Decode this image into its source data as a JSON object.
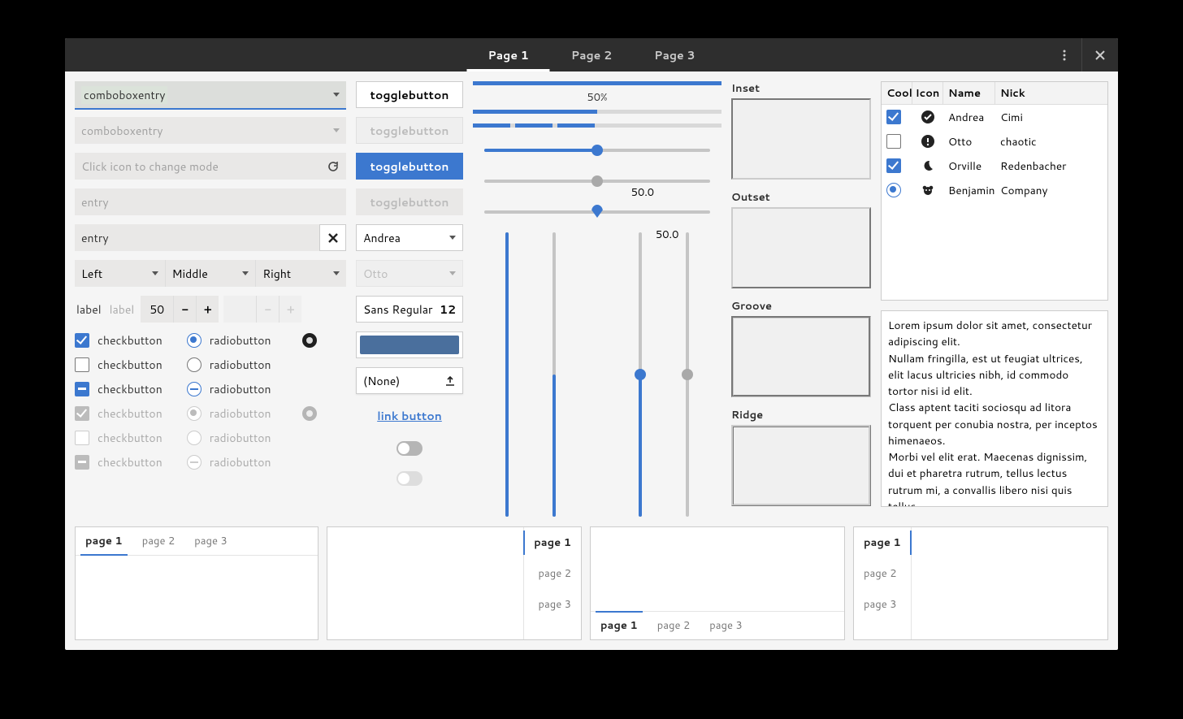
{
  "header": {
    "tabs": [
      "Page 1",
      "Page 2",
      "Page 3"
    ],
    "active_tab": 0
  },
  "col1": {
    "combobox_active": "comboboxentry",
    "combobox_disabled": "comboboxentry",
    "icon_entry_placeholder": "Click icon to change mode",
    "entry_placeholder": "entry",
    "entry_value": "entry",
    "seg": [
      "Left",
      "Middle",
      "Right"
    ],
    "label": "label",
    "label_dim": "label",
    "spin_value": "50",
    "checks": [
      "checkbutton",
      "checkbutton",
      "checkbutton",
      "checkbutton",
      "checkbutton",
      "checkbutton"
    ],
    "radios": [
      "radiobutton",
      "radiobutton",
      "radiobutton",
      "radiobutton",
      "radiobutton",
      "radiobutton"
    ]
  },
  "col2": {
    "toggles": [
      "togglebutton",
      "togglebutton",
      "togglebutton",
      "togglebutton"
    ],
    "select_andrea": "Andrea",
    "select_otto": "Otto",
    "font_label": "Sans Regular",
    "font_size": "12",
    "file_label": "(None)",
    "link_label": "link button",
    "color": "#4a6f9d"
  },
  "col3": {
    "progress_pct": 50,
    "progress_label": "50%",
    "hslider1": 50,
    "hslider2": 50,
    "hslider3": 50,
    "hslider3_label": "50.0",
    "vslider": 50
  },
  "col4": {
    "frames": [
      "Inset",
      "Outset",
      "Groove",
      "Ridge"
    ]
  },
  "col5": {
    "headers": [
      "Cool",
      "Icon",
      "Name",
      "Nick"
    ],
    "rows": [
      {
        "cool": "check",
        "icon": "circle-check",
        "name": "Andrea",
        "nick": "Cimi"
      },
      {
        "cool": "unchecked",
        "icon": "warning",
        "name": "Otto",
        "nick": "chaotic"
      },
      {
        "cool": "check",
        "icon": "moon",
        "name": "Orville",
        "nick": "Redenbacher"
      },
      {
        "cool": "radio",
        "icon": "crown",
        "name": "Benjamin",
        "nick": "Company"
      }
    ],
    "lorem": "Lorem ipsum dolor sit amet, consectetur adipiscing elit.\nNullam fringilla, est ut feugiat ultrices, elit lacus ultricies nibh, id commodo tortor nisi id elit.\nClass aptent taciti sociosqu ad litora torquent per conubia nostra, per inceptos himenaeos.\nMorbi vel elit erat. Maecenas dignissim, dui et pharetra rutrum, tellus lectus rutrum mi, a convallis libero nisi quis tellus.\nNulla facilisi. Nullam eleifend lobortis"
  },
  "notebooks": {
    "pages": [
      "page 1",
      "page 2",
      "page 3"
    ]
  }
}
